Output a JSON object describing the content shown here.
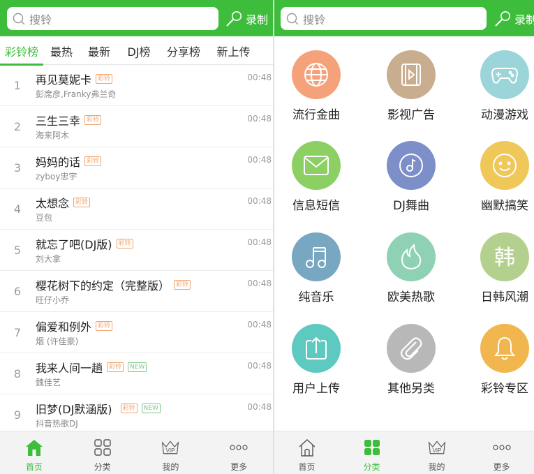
{
  "search": {
    "placeholder": "搜铃",
    "record_label": "录制"
  },
  "tabs": [
    {
      "label": "彩铃榜",
      "active": true
    },
    {
      "label": "最热"
    },
    {
      "label": "最新"
    },
    {
      "label": "DJ榜"
    },
    {
      "label": "分享榜"
    },
    {
      "label": "新上传"
    }
  ],
  "songs": [
    {
      "num": "1",
      "title": "再见莫妮卡",
      "artist": "彭席彦,Franky弗兰奇",
      "duration": "00:48",
      "badge": "彩铃",
      "new": ""
    },
    {
      "num": "2",
      "title": "三生三幸",
      "artist": "海来阿木",
      "duration": "00:48",
      "badge": "彩铃",
      "new": ""
    },
    {
      "num": "3",
      "title": "妈妈的话",
      "artist": "zyboy忠宇",
      "duration": "00:48",
      "badge": "彩铃",
      "new": ""
    },
    {
      "num": "4",
      "title": "太想念",
      "artist": "豆包",
      "duration": "00:48",
      "badge": "彩铃",
      "new": ""
    },
    {
      "num": "5",
      "title": "就忘了吧(DJ版)",
      "artist": "刘大拿",
      "duration": "00:48",
      "badge": "彩铃",
      "new": ""
    },
    {
      "num": "6",
      "title": "樱花树下的约定（完整版）",
      "artist": "旺仔小乔",
      "duration": "00:48",
      "badge": "彩铃",
      "new": ""
    },
    {
      "num": "7",
      "title": "偏爱和例外",
      "artist": "烟 (许佳豪)",
      "duration": "00:48",
      "badge": "彩铃",
      "new": ""
    },
    {
      "num": "8",
      "title": "我来人间一趟",
      "artist": "魏佳艺",
      "duration": "00:48",
      "badge": "彩铃",
      "new": "NEW"
    },
    {
      "num": "9",
      "title": "旧梦(DJ默涵版)",
      "artist": "抖音热歌DJ",
      "duration": "00:48",
      "badge": "彩铃",
      "new": "NEW"
    }
  ],
  "categories": [
    {
      "label": "流行金曲",
      "icon": "globe-icon",
      "color": "#f5a27a"
    },
    {
      "label": "影视广告",
      "icon": "film-icon",
      "color": "#c9ad8f"
    },
    {
      "label": "动漫游戏",
      "icon": "gamepad-icon",
      "color": "#9bd5d9"
    },
    {
      "label": "信息短信",
      "icon": "envelope-icon",
      "color": "#8ccf62"
    },
    {
      "label": "DJ舞曲",
      "icon": "disc-icon",
      "color": "#7c8fc9"
    },
    {
      "label": "幽默搞笑",
      "icon": "smile-icon",
      "color": "#f0c85a"
    },
    {
      "label": "纯音乐",
      "icon": "music-note-icon",
      "color": "#78a7c1"
    },
    {
      "label": "欧美热歌",
      "icon": "flame-icon",
      "color": "#8ed1b3"
    },
    {
      "label": "日韩风潮",
      "icon": "han-char-icon",
      "color": "#b4d08e"
    },
    {
      "label": "用户上传",
      "icon": "upload-icon",
      "color": "#5ec9c0"
    },
    {
      "label": "其他另类",
      "icon": "paperclip-icon",
      "color": "#b8b8b8"
    },
    {
      "label": "彩铃专区",
      "icon": "bell-icon",
      "color": "#f2b64f"
    }
  ],
  "nav_left": [
    {
      "label": "首页",
      "icon": "home-icon",
      "active": true
    },
    {
      "label": "分类",
      "icon": "grid-icon"
    },
    {
      "label": "我的",
      "icon": "vip-crown-icon"
    },
    {
      "label": "更多",
      "icon": "more-dots-icon"
    }
  ],
  "nav_right": [
    {
      "label": "首页",
      "icon": "home-icon"
    },
    {
      "label": "分类",
      "icon": "grid-icon",
      "active": true
    },
    {
      "label": "我的",
      "icon": "vip-crown-icon"
    },
    {
      "label": "更多",
      "icon": "more-dots-icon"
    }
  ],
  "vip_text": "VIP",
  "han_char": "韩",
  "colors": {
    "brand": "#3dbd3b",
    "badge": "#f2a46a",
    "new_badge": "#7cc78a"
  }
}
